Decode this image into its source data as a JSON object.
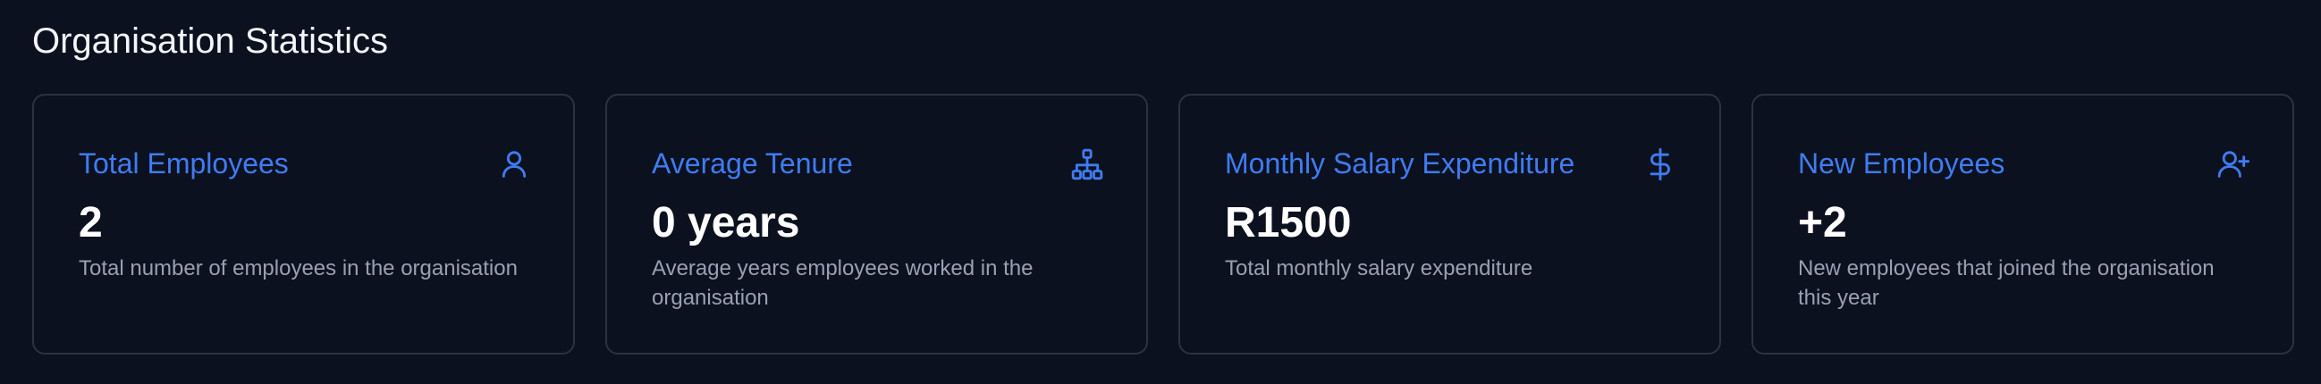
{
  "page": {
    "title": "Organisation Statistics"
  },
  "theme": {
    "background": "#0c111f",
    "accent": "#3f7cf3",
    "card_border": "#2c323f",
    "muted_text": "#98a1b3"
  },
  "cards": [
    {
      "title": "Total Employees",
      "value": "2",
      "description": "Total number of employees in the organisation",
      "icon": "user-icon"
    },
    {
      "title": "Average Tenure",
      "value": "0 years",
      "description": "Average years employees worked in the organisation",
      "icon": "org-chart-icon"
    },
    {
      "title": "Monthly Salary Expenditure",
      "value": "R1500",
      "description": "Total monthly salary expenditure",
      "icon": "dollar-icon"
    },
    {
      "title": "New Employees",
      "value": "+2",
      "description": "New employees that joined the organisation this year",
      "icon": "user-plus-icon"
    }
  ]
}
